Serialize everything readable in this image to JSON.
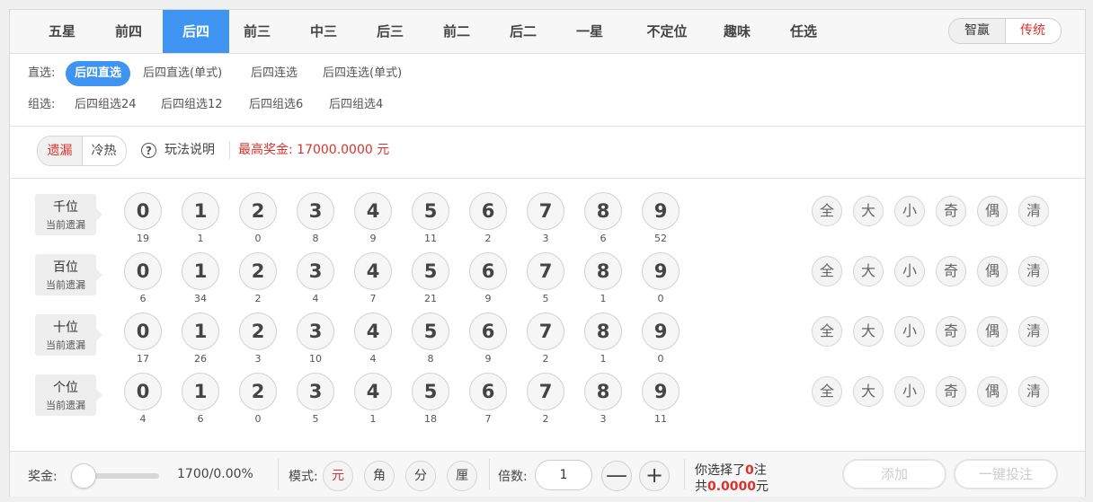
{
  "tabs": [
    "五星",
    "前四",
    "后四",
    "前三",
    "中三",
    "后三",
    "前二",
    "后二",
    "一星",
    "不定位",
    "趣味",
    "任选"
  ],
  "active_tab_index": 2,
  "mode_toggle": {
    "left": "智赢",
    "right": "传统"
  },
  "subtypes": {
    "direct": {
      "label": "直选:",
      "items": [
        "后四直选",
        "后四直选(单式)",
        "后四连选",
        "后四连选(单式)"
      ]
    },
    "group": {
      "label": "组选:",
      "items": [
        "后四组选24",
        "后四组选12",
        "后四组选6",
        "后四组选4"
      ]
    }
  },
  "toolbar": {
    "seg_left": "遗漏",
    "seg_right": "冷热",
    "help_label": "玩法说明",
    "max_prize": "最高奖金: 17000.0000 元"
  },
  "rows": [
    {
      "name": "千位",
      "sub": "当前遗漏",
      "missing": [
        "19",
        "1",
        "0",
        "8",
        "9",
        "11",
        "2",
        "3",
        "6",
        "52"
      ]
    },
    {
      "name": "百位",
      "sub": "当前遗漏",
      "missing": [
        "6",
        "34",
        "2",
        "4",
        "7",
        "21",
        "9",
        "5",
        "1",
        "0"
      ]
    },
    {
      "name": "十位",
      "sub": "当前遗漏",
      "missing": [
        "17",
        "26",
        "3",
        "10",
        "4",
        "8",
        "9",
        "2",
        "1",
        "0"
      ]
    },
    {
      "name": "个位",
      "sub": "当前遗漏",
      "missing": [
        "4",
        "6",
        "0",
        "5",
        "1",
        "18",
        "7",
        "2",
        "3",
        "11"
      ]
    }
  ],
  "digits": [
    "0",
    "1",
    "2",
    "3",
    "4",
    "5",
    "6",
    "7",
    "8",
    "9"
  ],
  "quick_buttons": [
    "全",
    "大",
    "小",
    "奇",
    "偶",
    "清"
  ],
  "bottom": {
    "prize_label": "奖金:",
    "slider_value": 0,
    "rate": "1700/0.00%",
    "mode_label": "模式:",
    "modes": [
      "元",
      "角",
      "分",
      "厘"
    ],
    "mode_selected": "元",
    "multiple_label": "倍数:",
    "multiple_value": "1",
    "minus": "—",
    "plus": "+",
    "selected_prefix": "你选择了",
    "selected_count": "0",
    "selected_suffix": "注",
    "total_prefix": "共",
    "total_amount": "0.0000",
    "total_suffix": "元",
    "add_button": "添加",
    "bet_button": "一键投注"
  },
  "colors": {
    "accent": "#3e94f0",
    "red": "#d9322d"
  }
}
